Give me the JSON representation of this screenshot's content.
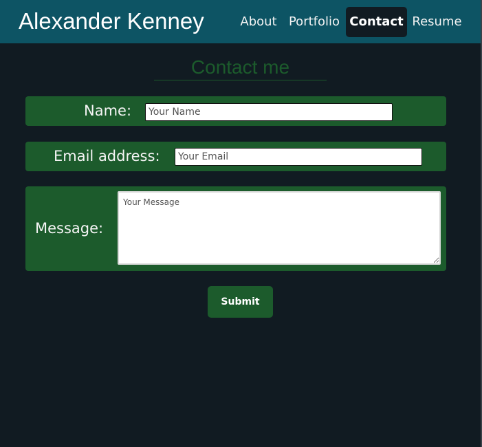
{
  "site": {
    "title": "Alexander Kenney"
  },
  "nav": {
    "items": [
      {
        "label": "About",
        "active": false
      },
      {
        "label": "Portfolio",
        "active": false
      },
      {
        "label": "Contact",
        "active": true
      },
      {
        "label": "Resume",
        "active": false
      }
    ]
  },
  "contact": {
    "heading": "Contact me",
    "name_label": "Name:",
    "name_placeholder": "Your Name",
    "email_label": "Email address:",
    "email_placeholder": "Your Email",
    "message_label": "Message:",
    "message_placeholder": "Your Message",
    "submit_label": "Submit"
  },
  "colors": {
    "header_bg": "#0d5464",
    "page_bg": "#111b22",
    "accent_green": "#1c5b2c",
    "text_light": "#ffffff"
  }
}
